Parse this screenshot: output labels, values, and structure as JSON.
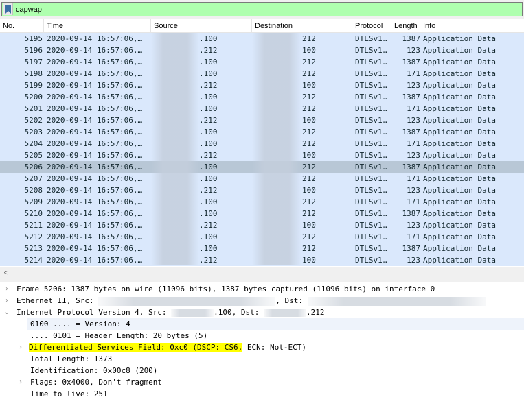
{
  "filter": {
    "value": "capwap"
  },
  "columns": {
    "no": "No.",
    "time": "Time",
    "source": "Source",
    "destination": "Destination",
    "protocol": "Protocol",
    "length": "Length",
    "info": "Info"
  },
  "rows": [
    {
      "no": "5195",
      "time": "2020-09-14 16:57:06,…",
      "src": ".100",
      "dst": "212",
      "proto": "DTLSv1…",
      "len": "1387",
      "info": "Application Data"
    },
    {
      "no": "5196",
      "time": "2020-09-14 16:57:06,…",
      "src": ".212",
      "dst": "100",
      "proto": "DTLSv1…",
      "len": "123",
      "info": "Application Data"
    },
    {
      "no": "5197",
      "time": "2020-09-14 16:57:06,…",
      "src": ".100",
      "dst": "212",
      "proto": "DTLSv1…",
      "len": "1387",
      "info": "Application Data"
    },
    {
      "no": "5198",
      "time": "2020-09-14 16:57:06,…",
      "src": ".100",
      "dst": "212",
      "proto": "DTLSv1…",
      "len": "171",
      "info": "Application Data"
    },
    {
      "no": "5199",
      "time": "2020-09-14 16:57:06,…",
      "src": ".212",
      "dst": "100",
      "proto": "DTLSv1…",
      "len": "123",
      "info": "Application Data"
    },
    {
      "no": "5200",
      "time": "2020-09-14 16:57:06,…",
      "src": ".100",
      "dst": "212",
      "proto": "DTLSv1…",
      "len": "1387",
      "info": "Application Data"
    },
    {
      "no": "5201",
      "time": "2020-09-14 16:57:06,…",
      "src": ".100",
      "dst": "212",
      "proto": "DTLSv1…",
      "len": "171",
      "info": "Application Data"
    },
    {
      "no": "5202",
      "time": "2020-09-14 16:57:06,…",
      "src": ".212",
      "dst": "100",
      "proto": "DTLSv1…",
      "len": "123",
      "info": "Application Data"
    },
    {
      "no": "5203",
      "time": "2020-09-14 16:57:06,…",
      "src": ".100",
      "dst": "212",
      "proto": "DTLSv1…",
      "len": "1387",
      "info": "Application Data"
    },
    {
      "no": "5204",
      "time": "2020-09-14 16:57:06,…",
      "src": ".100",
      "dst": "212",
      "proto": "DTLSv1…",
      "len": "171",
      "info": "Application Data"
    },
    {
      "no": "5205",
      "time": "2020-09-14 16:57:06,…",
      "src": ".212",
      "dst": "100",
      "proto": "DTLSv1…",
      "len": "123",
      "info": "Application Data"
    },
    {
      "no": "5206",
      "time": "2020-09-14 16:57:06,…",
      "src": ".100",
      "dst": "212",
      "proto": "DTLSv1…",
      "len": "1387",
      "info": "Application Data",
      "selected": true
    },
    {
      "no": "5207",
      "time": "2020-09-14 16:57:06,…",
      "src": ".100",
      "dst": "212",
      "proto": "DTLSv1…",
      "len": "171",
      "info": "Application Data"
    },
    {
      "no": "5208",
      "time": "2020-09-14 16:57:06,…",
      "src": ".212",
      "dst": "100",
      "proto": "DTLSv1…",
      "len": "123",
      "info": "Application Data"
    },
    {
      "no": "5209",
      "time": "2020-09-14 16:57:06,…",
      "src": ".100",
      "dst": "212",
      "proto": "DTLSv1…",
      "len": "171",
      "info": "Application Data"
    },
    {
      "no": "5210",
      "time": "2020-09-14 16:57:06,…",
      "src": ".100",
      "dst": "212",
      "proto": "DTLSv1…",
      "len": "1387",
      "info": "Application Data"
    },
    {
      "no": "5211",
      "time": "2020-09-14 16:57:06,…",
      "src": ".212",
      "dst": "100",
      "proto": "DTLSv1…",
      "len": "123",
      "info": "Application Data"
    },
    {
      "no": "5212",
      "time": "2020-09-14 16:57:06,…",
      "src": ".100",
      "dst": "212",
      "proto": "DTLSv1…",
      "len": "171",
      "info": "Application Data"
    },
    {
      "no": "5213",
      "time": "2020-09-14 16:57:06,…",
      "src": ".100",
      "dst": "212",
      "proto": "DTLSv1…",
      "len": "1387",
      "info": "Application Data"
    },
    {
      "no": "5214",
      "time": "2020-09-14 16:57:06,…",
      "src": ".212",
      "dst": "100",
      "proto": "DTLSv1…",
      "len": "123",
      "info": "Application Data"
    }
  ],
  "scroll_left_glyph": "<",
  "details": {
    "frame": "Frame 5206: 1387 bytes on wire (11096 bits), 1387 bytes captured (11096 bits) on interface 0",
    "ethernet_prefix": "Ethernet II, Src:",
    "ethernet_dst": ", Dst:",
    "ip_prefix": "Internet Protocol Version 4, Src:",
    "ip_src_suffix": ".100, Dst:",
    "ip_dst_suffix": ".212",
    "version": "0100 .... = Version: 4",
    "header_length": ".... 0101 = Header Length: 20 bytes (5)",
    "dsf_highlight": "Differentiated Services Field: 0xc0 (DSCP: CS6,",
    "dsf_rest": " ECN: Not-ECT)",
    "total_length": "Total Length: 1373",
    "identification": "Identification: 0x00c8 (200)",
    "flags": "Flags: 0x4000, Don't fragment",
    "ttl": "Time to live: 251"
  },
  "colors": {
    "filter_ok": "#afffaf",
    "row_bg": "#dae8fc",
    "row_selected": "#b8c7d6",
    "highlight": "#ffff00"
  }
}
